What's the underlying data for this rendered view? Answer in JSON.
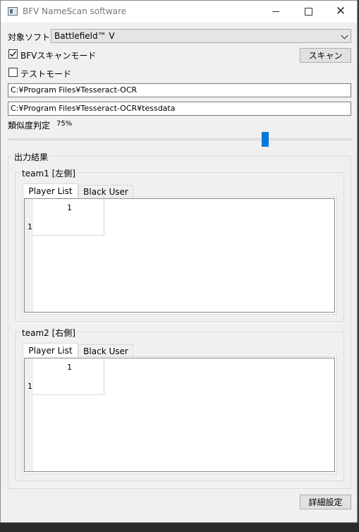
{
  "window": {
    "title": "BFV NameScan software",
    "close_glyph": "✕"
  },
  "target_software": {
    "label": "対象ソフト:",
    "selected": "Battlefield™ V"
  },
  "scan_mode": {
    "label": "BFVスキャンモード",
    "checked": true
  },
  "test_mode": {
    "label": "テストモード",
    "checked": false
  },
  "scan_button": {
    "label": "スキャン"
  },
  "paths": {
    "tesseract": "C:¥Program Files¥Tesseract-OCR",
    "tessdata": "C:¥Program Files¥Tesseract-OCR¥tessdata"
  },
  "similarity": {
    "label": "類似度判定",
    "value": "75%",
    "slider_fraction": 0.75
  },
  "output": {
    "title": "出力結果",
    "team1": {
      "title": "team1 [左側]",
      "tabs": [
        "Player List",
        "Black User"
      ],
      "active_tab": 0,
      "grid": {
        "column_header": "1",
        "row_header": "1"
      }
    },
    "team2": {
      "title": "team2 [右側]",
      "tabs": [
        "Player List",
        "Black User"
      ],
      "active_tab": 0,
      "grid": {
        "column_header": "1",
        "row_header": "1"
      }
    }
  },
  "settings_button": {
    "label": "詳細設定"
  },
  "colors": {
    "accent": "#0078d7",
    "window_bg": "#f0f0f0"
  },
  "icons": [
    "app-icon",
    "minimize-icon",
    "maximize-icon",
    "close-icon",
    "dropdown-arrow-icon",
    "checkmark-icon"
  ]
}
